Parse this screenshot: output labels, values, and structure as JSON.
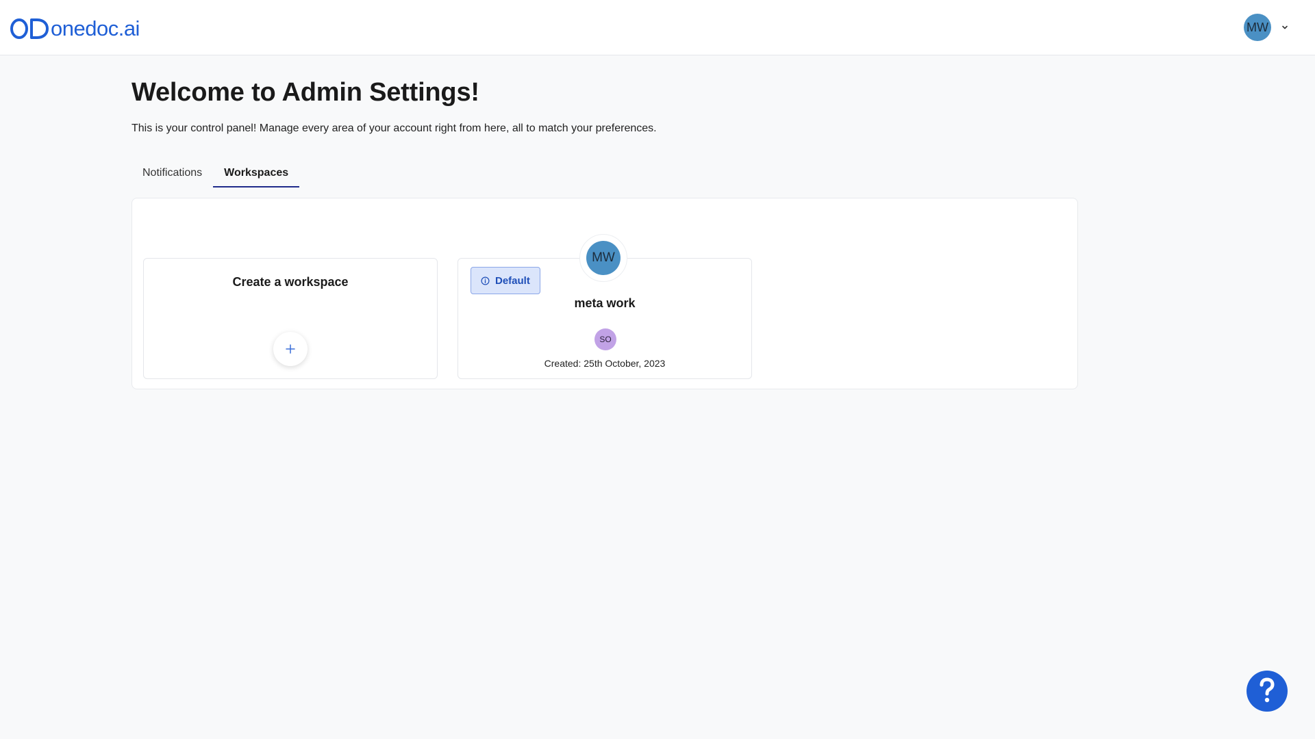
{
  "brand": {
    "name": "onedoc.ai",
    "color": "#1f5fd6"
  },
  "header": {
    "user_initials": "MW",
    "avatar_color": "#4a90c4",
    "menu_icon": "chevron-down-icon"
  },
  "page": {
    "title": "Welcome to Admin Settings!",
    "description": "This is your control panel! Manage every area of your account right from here, all to match your preferences."
  },
  "tabs": [
    {
      "label": "Notifications",
      "active": false
    },
    {
      "label": "Workspaces",
      "active": true
    }
  ],
  "create_card": {
    "title": "Create a workspace",
    "icon": "plus-icon"
  },
  "workspace": {
    "initials": "MW",
    "avatar_color": "#4a90c4",
    "badge_label": "Default",
    "badge_icon": "info-icon",
    "name": "meta work",
    "member_initials": "SO",
    "member_color": "#c1a2e6",
    "created": "Created: 25th October, 2023"
  },
  "help": {
    "icon": "question-mark-icon",
    "label": "?"
  },
  "colors": {
    "accent": "#1f5fd6",
    "tab_underline": "#1e2a8a",
    "badge_bg": "#dbe5fb"
  }
}
